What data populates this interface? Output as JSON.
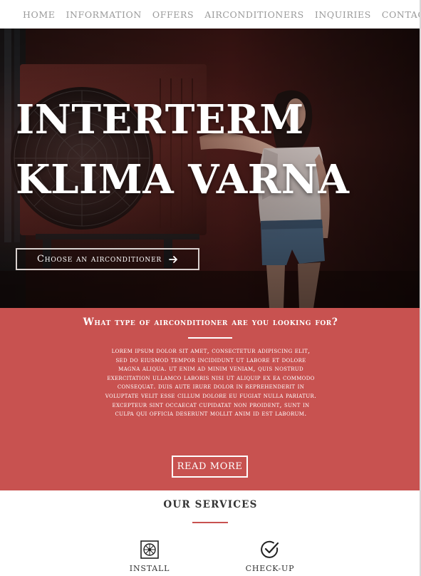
{
  "nav": {
    "items": [
      {
        "label": "HOME"
      },
      {
        "label": "INFORMATION"
      },
      {
        "label": "OFFERS"
      },
      {
        "label": "AIRCONDITIONERS"
      },
      {
        "label": "INQUIRIES"
      },
      {
        "label": "CONTACTS"
      }
    ]
  },
  "hero": {
    "title_line1": "INTERTERM",
    "title_line2": "KLIMA VARNA",
    "cta_label": "Choose an airconditioner",
    "cta_icon": "arrow-right-icon"
  },
  "feature": {
    "title": "What type of airconditioner are you looking for?",
    "body": "Lorem ipsum dolor sit amet, consectetur adipiscing elit, sed do eiusmod tempor incididunt ut labore et dolore magna aliqua. Ut enim ad minim veniam, quis nostrud exercitation ullamco laboris nisi ut aliquip ex ea commodo consequat. Duis aute irure dolor in reprehenderit in voluptate velit esse cillum dolore eu fugiat nulla pariatur. Excepteur sint occaecat cupidatat non proident, sunt in culpa qui officia deserunt mollit anim id est laborum.",
    "button_label": "READ MORE",
    "background_color": "#c85250"
  },
  "services": {
    "title": "OUR SERVICES",
    "accent_color": "#c85250",
    "items": [
      {
        "label": "INSTALL",
        "icon": "ac-unit-icon"
      },
      {
        "label": "CHECK-UP",
        "icon": "check-circle-icon"
      }
    ]
  }
}
